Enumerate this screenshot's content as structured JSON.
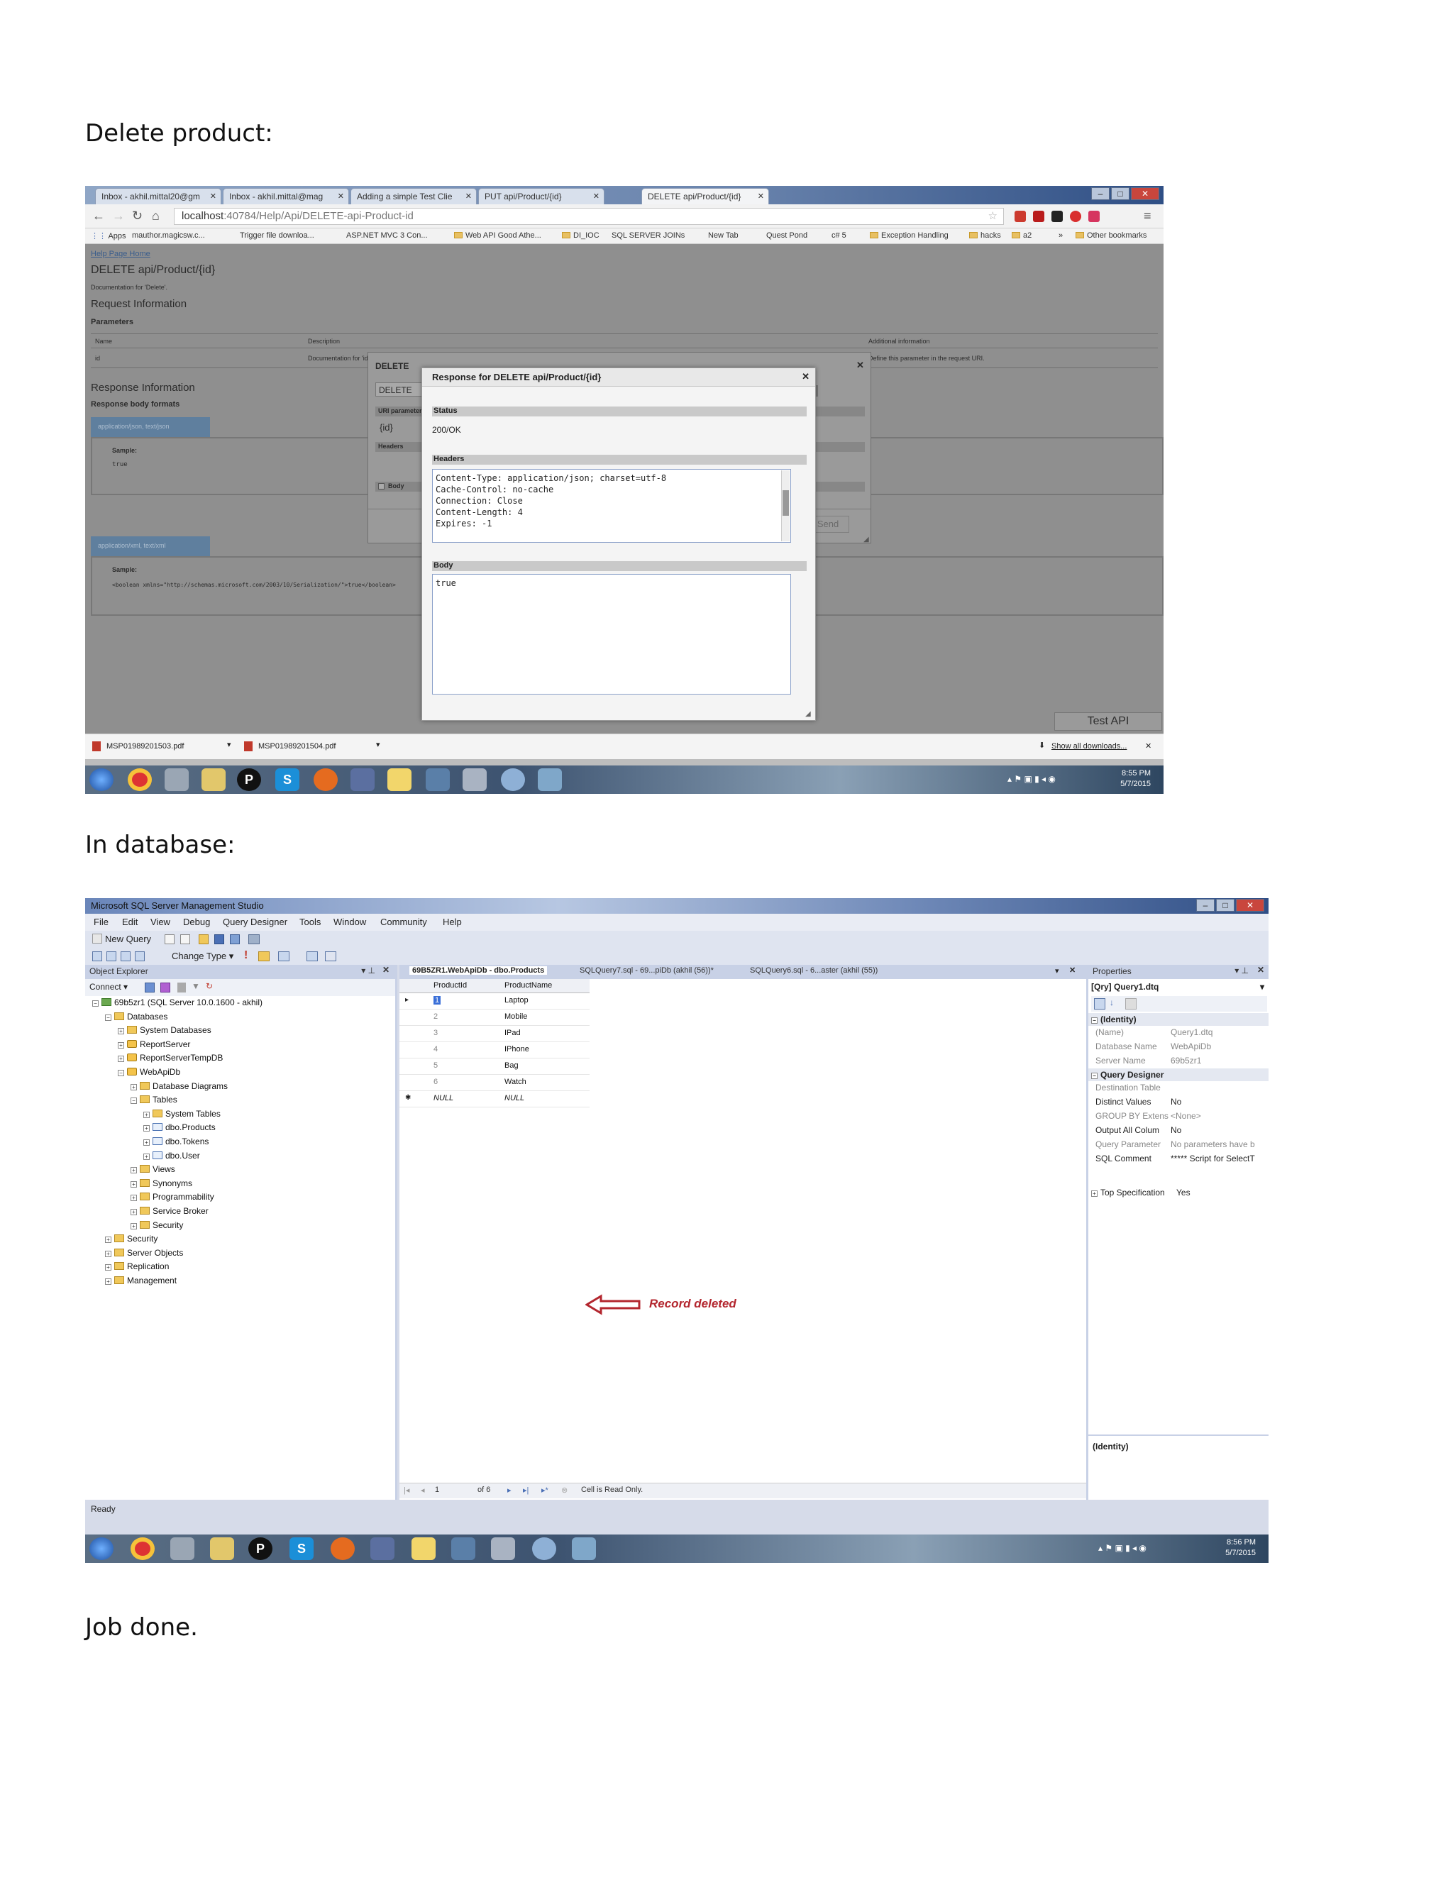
{
  "doc": {
    "heading1": "Delete product:",
    "heading2": "In database:",
    "heading3": "Job done."
  },
  "browser": {
    "tabs": [
      "Inbox - akhil.mittal20@gm",
      "Inbox - akhil.mittal@mag",
      "Adding a simple Test Clie",
      "PUT api/Product/{id}",
      "DELETE api/Product/{id}"
    ],
    "url_host": "localhost",
    "url_path": ":40784/Help/Api/DELETE-api-Product-id",
    "bookmarks": [
      "Apps",
      "mauthor.magicsw.c...",
      "Trigger file downloa...",
      "ASP.NET MVC 3 Con...",
      "Web API Good Athe...",
      "DI_IOC",
      "SQL SERVER JOINs",
      "New Tab",
      "Quest Pond",
      "c# 5",
      "Exception Handling",
      "hacks",
      "a2",
      "»",
      "Other bookmarks"
    ],
    "help_page": {
      "home_link": "Help Page Home",
      "title": "DELETE api/Product/{id}",
      "documentation": "Documentation for 'Delete'.",
      "request_info": "Request Information",
      "parameters": "Parameters",
      "col_name": "Name",
      "col_description": "Description",
      "col_additional": "Additional information",
      "row_name": "id",
      "row_description": "Documentation for 'id'.",
      "row_additional": "Define this parameter in the request URI.",
      "response_info": "Response Information",
      "response_formats": "Response body formats",
      "format_json": "application/json, text/json",
      "sample_label": "Sample:",
      "sample_json": "true",
      "format_xml": "application/xml, text/xml",
      "sample_xml": "<boolean xmlns=\"http://schemas.microsoft.com/2003/10/Serialization/\">true</boolean>",
      "test_api": "Test API"
    },
    "test_client": {
      "title": "DELETE",
      "method": "DELETE",
      "uri_params": "URI parameters",
      "uri_value": "{id}",
      "headers": "Headers",
      "body": "Body",
      "send": "Send"
    },
    "response_dialog": {
      "title": "Response for DELETE api/Product/{id}",
      "status_label": "Status",
      "status_value": "200/OK",
      "headers_label": "Headers",
      "headers_text": "Content-Type: application/json; charset=utf-8\nCache-Control: no-cache\nConnection: Close\nContent-Length: 4\nExpires: -1",
      "body_label": "Body",
      "body_text": "true"
    },
    "downloads": {
      "file1": "MSP01989201503.pdf",
      "file2": "MSP01989201504.pdf",
      "show_all": "Show all downloads..."
    },
    "clock_time": "8:55 PM",
    "clock_date": "5/7/2015"
  },
  "ssms": {
    "title": "Microsoft SQL Server Management Studio",
    "menu": [
      "File",
      "Edit",
      "View",
      "Debug",
      "Query Designer",
      "Tools",
      "Window",
      "Community",
      "Help"
    ],
    "new_query": "New Query",
    "change_type": "Change Type",
    "object_explorer": {
      "header": "Object Explorer",
      "connect": "Connect",
      "tree": [
        {
          "label": "69b5zr1 (SQL Server 10.0.1600 - akhil)",
          "level": 0,
          "icon": "server",
          "pm": "-"
        },
        {
          "label": "Databases",
          "level": 1,
          "icon": "folder",
          "pm": "-"
        },
        {
          "label": "System Databases",
          "level": 2,
          "icon": "folder",
          "pm": "+"
        },
        {
          "label": "ReportServer",
          "level": 2,
          "icon": "db",
          "pm": "+"
        },
        {
          "label": "ReportServerTempDB",
          "level": 2,
          "icon": "db",
          "pm": "+"
        },
        {
          "label": "WebApiDb",
          "level": 2,
          "icon": "db",
          "pm": "-"
        },
        {
          "label": "Database Diagrams",
          "level": 3,
          "icon": "folder",
          "pm": "+"
        },
        {
          "label": "Tables",
          "level": 3,
          "icon": "folder",
          "pm": "-"
        },
        {
          "label": "System Tables",
          "level": 4,
          "icon": "folder",
          "pm": "+"
        },
        {
          "label": "dbo.Products",
          "level": 4,
          "icon": "table",
          "pm": "+"
        },
        {
          "label": "dbo.Tokens",
          "level": 4,
          "icon": "table",
          "pm": "+"
        },
        {
          "label": "dbo.User",
          "level": 4,
          "icon": "table",
          "pm": "+"
        },
        {
          "label": "Views",
          "level": 3,
          "icon": "folder",
          "pm": "+"
        },
        {
          "label": "Synonyms",
          "level": 3,
          "icon": "folder",
          "pm": "+"
        },
        {
          "label": "Programmability",
          "level": 3,
          "icon": "folder",
          "pm": "+"
        },
        {
          "label": "Service Broker",
          "level": 3,
          "icon": "folder",
          "pm": "+"
        },
        {
          "label": "Security",
          "level": 3,
          "icon": "folder",
          "pm": "+"
        },
        {
          "label": "Security",
          "level": 1,
          "icon": "folder",
          "pm": "+"
        },
        {
          "label": "Server Objects",
          "level": 1,
          "icon": "folder",
          "pm": "+"
        },
        {
          "label": "Replication",
          "level": 1,
          "icon": "folder",
          "pm": "+"
        },
        {
          "label": "Management",
          "level": 1,
          "icon": "folder",
          "pm": "+"
        }
      ]
    },
    "doc_tabs": [
      "69B5ZR1.WebApiDb - dbo.Products",
      "SQLQuery7.sql - 69...piDb (akhil (56))*",
      "SQLQuery6.sql - 6...aster (akhil (55))"
    ],
    "grid": {
      "columns": [
        "ProductId",
        "ProductName"
      ],
      "rows": [
        [
          "1",
          "Laptop"
        ],
        [
          "2",
          "Mobile"
        ],
        [
          "3",
          "IPad"
        ],
        [
          "4",
          "IPhone"
        ],
        [
          "5",
          "Bag"
        ],
        [
          "6",
          "Watch"
        ],
        [
          "NULL",
          "NULL"
        ]
      ],
      "annotation": "Record deleted",
      "pager_current": "1",
      "pager_total": "of 6",
      "pager_status": "Cell is Read Only."
    },
    "properties": {
      "header": "Properties",
      "object": "[Qry] Query1.dtq",
      "cat_identity": "(Identity)",
      "rows": [
        {
          "name": "(Name)",
          "value": "Query1.dtq",
          "grey": true
        },
        {
          "name": "Database Name",
          "value": "WebApiDb",
          "grey": true
        },
        {
          "name": "Server Name",
          "value": "69b5zr1",
          "grey": true
        }
      ],
      "cat_designer": "Query Designer",
      "designer_rows": [
        {
          "name": "Destination Table",
          "value": "",
          "grey": true
        },
        {
          "name": "Distinct Values",
          "value": "No",
          "grey": false
        },
        {
          "name": "GROUP BY Extens",
          "value": "<None>",
          "grey": true
        },
        {
          "name": "Output All Colum",
          "value": "No",
          "grey": false
        },
        {
          "name": "Query Parameter",
          "value": "No parameters have b",
          "grey": true
        },
        {
          "name": "SQL Comment",
          "value": "***** Script for SelectT",
          "grey": false
        }
      ],
      "cat_top": "Top Specification",
      "top_value": "Yes",
      "description": "(Identity)"
    },
    "status": "Ready",
    "clock_time": "8:56 PM",
    "clock_date": "5/7/2015"
  },
  "colors": {
    "annotation_red": "#b3262e",
    "taskbar": "#3d5370"
  }
}
